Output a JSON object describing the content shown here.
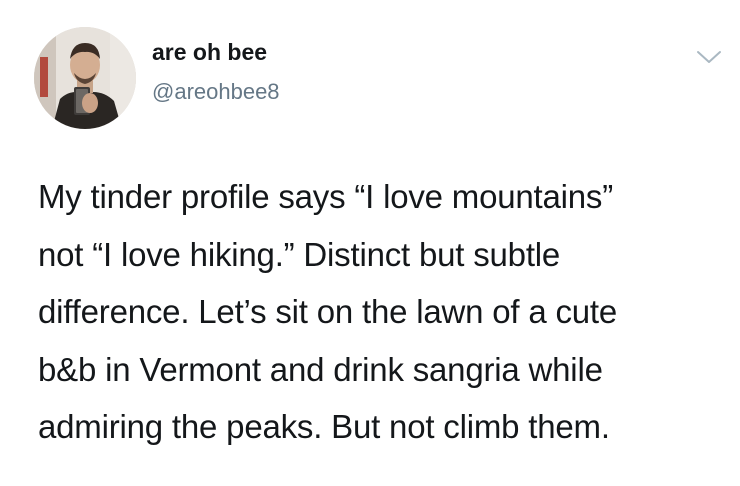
{
  "tweet": {
    "author": {
      "display_name": "are oh bee",
      "handle": "@areohbee8"
    },
    "menu_icon": "chevron-down-icon",
    "text_lines": [
      "My tinder profile says “I love mountains”",
      "not “I love hiking.” Distinct but subtle",
      "difference. Let’s sit on the lawn of a cute",
      "b&b in Vermont and drink sangria while",
      "admiring the peaks. But not climb them."
    ]
  },
  "colors": {
    "text_primary": "#14171a",
    "text_secondary": "#657786",
    "chevron": "#aab8c2",
    "background": "#ffffff"
  }
}
